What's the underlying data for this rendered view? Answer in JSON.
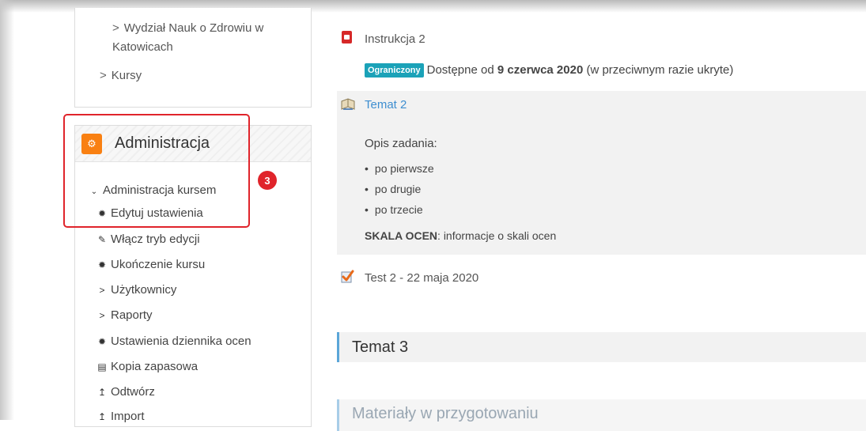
{
  "navigation": {
    "items": [
      {
        "label": "Wydział Nauk o Zdrowiu w",
        "label2": "Katowicach"
      },
      {
        "label": "Kursy"
      }
    ]
  },
  "admin": {
    "title": "Administracja",
    "course_admin": "Administracja kursem",
    "items": [
      {
        "label": "Edytuj ustawienia",
        "icon": "gear-icon"
      },
      {
        "label": "Włącz tryb edycji",
        "icon": "pencil-icon"
      },
      {
        "label": "Ukończenie kursu",
        "icon": "gear-icon"
      },
      {
        "label": "Użytkownicy",
        "icon": "chevron-right-icon"
      },
      {
        "label": "Raporty",
        "icon": "chevron-right-icon"
      },
      {
        "label": "Ustawienia dziennika ocen",
        "icon": "gear-icon"
      },
      {
        "label": "Kopia zapasowa",
        "icon": "file-icon"
      },
      {
        "label": "Odtwórz",
        "icon": "upload-icon"
      },
      {
        "label": "Import",
        "icon": "upload-icon"
      }
    ],
    "annotation_badge": "3"
  },
  "content": {
    "resource": "Instrukcja 2",
    "restriction": {
      "badge": "Ograniczony",
      "prefix": "Dostępne od",
      "date": "9 czerwca 2020",
      "suffix": "(w przeciwnym razie ukryte)"
    },
    "assignment": {
      "title": "Temat 2",
      "description_label": "Opis zadania:",
      "bullets": [
        "po pierwsze",
        "po drugie",
        "po trzecie"
      ],
      "grade_label": "SKALA OCEN",
      "grade_text": ": informacje o skali ocen"
    },
    "quiz": "Test 2 - 22 maja 2020",
    "sections": [
      "Temat 3",
      "Materiały w przygotowaniu"
    ]
  },
  "colors": {
    "accent": "#f98012",
    "link": "#3e8ed0",
    "badge": "#1ba2b8",
    "annotation": "#e0242b"
  }
}
